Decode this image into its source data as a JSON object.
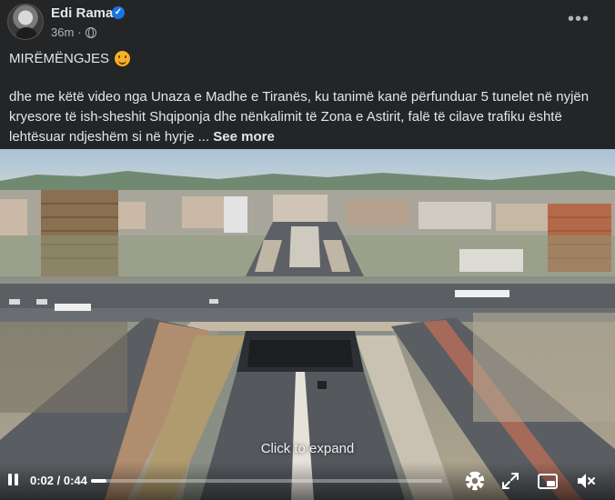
{
  "post": {
    "author": "Edi Rama",
    "time": "36m",
    "greeting": "MIRËMËNGJES",
    "body": "dhe me këtë video nga Unaza e Madhe e Tiranës, ku tanimë kanë përfunduar 5 tunelet në nyjën kryesore të ish-sheshit Shqiponja dhe nënkalimit të Zona e Astirit, falë të cilave trafiku është lehtësuar ndjeshëm si në hyrje ...",
    "see_more": "See more"
  },
  "video": {
    "expand_hint": "Click to expand",
    "current_time": "0:02",
    "duration": "0:44",
    "time_display": "0:02 / 0:44",
    "progress_fraction": 0.045
  },
  "icons": {
    "verified": "verified-badge-icon",
    "privacy": "globe-icon",
    "more": "more-options-icon",
    "emoji": "smiling-face-emoji",
    "pause": "pause-icon",
    "settings": "gear-icon",
    "expand": "expand-icon",
    "pip": "picture-in-picture-icon",
    "mute": "volume-muted-icon"
  },
  "colors": {
    "background": "#242526",
    "text_primary": "#e4e6eb",
    "text_secondary": "#b0b3b8",
    "verified_blue": "#1b74e4"
  }
}
